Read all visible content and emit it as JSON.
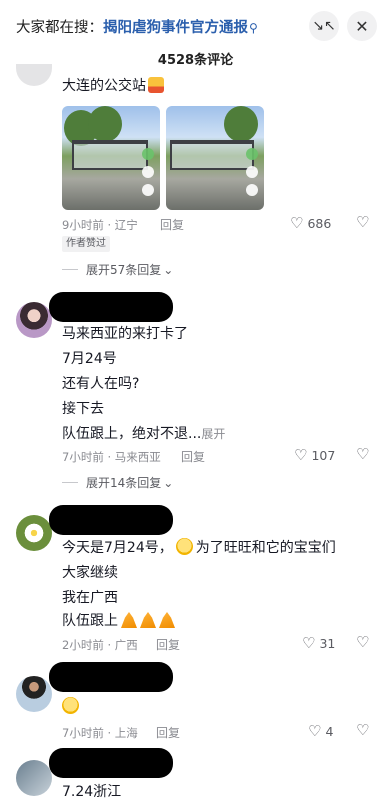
{
  "header": {
    "search_prefix": "大家都在搜：",
    "search_keyword": "揭阳虐狗事件官方通报",
    "search_icon": "magnifier-icon",
    "collapse_icon": "collapse-arrows-icon",
    "close_icon": "close-x-icon",
    "comment_count": "4528条评论"
  },
  "comments": [
    {
      "text_lines": [
        "大连的公交站"
      ],
      "emoji": "scared-face-emoji",
      "meta": "9小时前 · 辽宁",
      "reply_label": "回复",
      "likes": "686",
      "badge": "作者赞过",
      "expand_label": "展开57条回复"
    },
    {
      "text_lines": [
        "马来西亚的来打卡了",
        "7月24号",
        "还有人在吗?",
        "接下去",
        "队伍跟上，绝对不退..."
      ],
      "more_label": "展开",
      "meta": "7小时前 · 马来西亚",
      "reply_label": "回复",
      "likes": "107",
      "expand_label": "展开14条回复"
    },
    {
      "text_lines": [
        "今天是7月24号，",
        "为了旺旺和它的宝宝们",
        "大家继续",
        "我在广西",
        "队伍跟上"
      ],
      "emoji": "crying-face-emoji",
      "meta": "2小时前 · 广西",
      "reply_label": "回复",
      "likes": "31"
    },
    {
      "emoji": "crying-face-emoji",
      "meta": "7小时前 · 上海",
      "reply_label": "回复",
      "likes": "4"
    },
    {
      "text_lines": [
        "7.24浙江"
      ]
    }
  ],
  "colors": {
    "keyword": "#2b5fad",
    "meta": "#8a8b91",
    "text": "#161823"
  }
}
